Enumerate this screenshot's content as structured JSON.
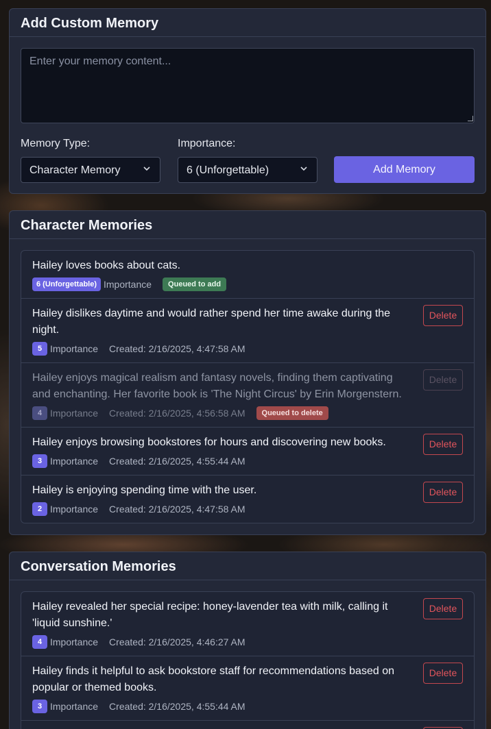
{
  "add_panel": {
    "title": "Add Custom Memory",
    "textarea_placeholder": "Enter your memory content...",
    "memory_type_label": "Memory Type:",
    "memory_type_value": "Character Memory",
    "importance_label": "Importance:",
    "importance_value": "6 (Unforgettable)",
    "add_button": "Add Memory"
  },
  "character_memories": {
    "title": "Character Memories",
    "importance_word": "Importance",
    "delete_label": "Delete",
    "items": [
      {
        "text": "Hailey loves books about cats.",
        "importance": "6 (Unforgettable)",
        "created": "",
        "status": "Queued to add"
      },
      {
        "text": "Hailey dislikes daytime and would rather spend her time awake during the night.",
        "importance": "5",
        "created": "Created: 2/16/2025, 4:47:58 AM",
        "status": ""
      },
      {
        "text": "Hailey enjoys magical realism and fantasy novels, finding them captivating and enchanting. Her favorite book is 'The Night Circus' by Erin Morgenstern.",
        "importance": "4",
        "created": "Created: 2/16/2025, 4:56:58 AM",
        "status": "Queued to delete"
      },
      {
        "text": "Hailey enjoys browsing bookstores for hours and discovering new books.",
        "importance": "3",
        "created": "Created: 2/16/2025, 4:55:44 AM",
        "status": ""
      },
      {
        "text": "Hailey is enjoying spending time with the user.",
        "importance": "2",
        "created": "Created: 2/16/2025, 4:47:58 AM",
        "status": ""
      }
    ]
  },
  "conversation_memories": {
    "title": "Conversation Memories",
    "importance_word": "Importance",
    "delete_label": "Delete",
    "items": [
      {
        "text": "Hailey revealed her special recipe: honey-lavender tea with milk, calling it 'liquid sunshine.'",
        "importance": "4",
        "created": "Created: 2/16/2025, 4:46:27 AM"
      },
      {
        "text": "Hailey finds it helpful to ask bookstore staff for recommendations based on popular or themed books.",
        "importance": "3",
        "created": "Created: 2/16/2025, 4:55:44 AM"
      }
    ]
  },
  "colors": {
    "accent": "#6a63e2",
    "panel_bg": "#232838",
    "delete_red": "#e2555c",
    "queued_add_green": "#3d7a54",
    "queued_delete_red": "#a04a4a"
  }
}
